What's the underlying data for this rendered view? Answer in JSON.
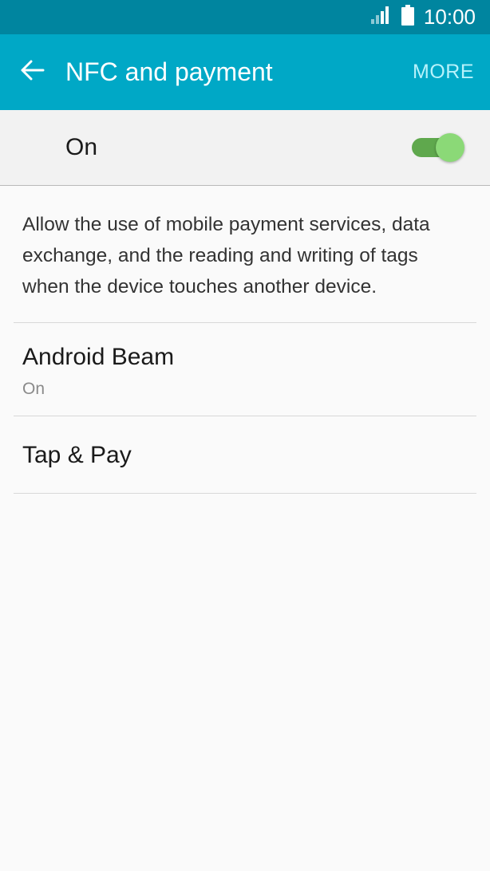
{
  "status_bar": {
    "time": "10:00",
    "signal_icon": "signal-bars-icon",
    "battery_icon": "battery-icon"
  },
  "app_bar": {
    "title": "NFC and payment",
    "back_icon": "arrow-left-icon",
    "more_label": "MORE"
  },
  "master_switch": {
    "label": "On",
    "state": "on"
  },
  "description": "Allow the use of mobile payment services, data exchange, and the reading and writing of tags when the device touches another device.",
  "items": [
    {
      "title": "Android Beam",
      "subtitle": "On"
    },
    {
      "title": "Tap & Pay"
    }
  ],
  "colors": {
    "status_bar": "#00859f",
    "app_bar": "#00a8c6",
    "more_text": "#b7f2fb",
    "switch_track": "#5fa84d",
    "switch_thumb": "#8bd977"
  }
}
